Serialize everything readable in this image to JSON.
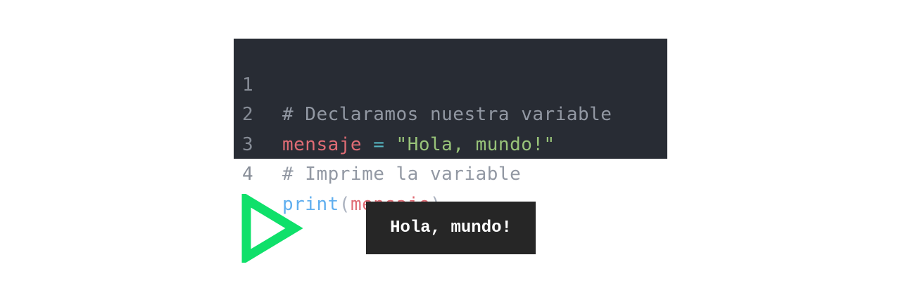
{
  "code_editor": {
    "lines": [
      {
        "number": "1",
        "tokens": [
          {
            "type": "comment",
            "text": "# Declaramos nuestra variable"
          }
        ]
      },
      {
        "number": "2",
        "tokens": [
          {
            "type": "var",
            "text": "mensaje"
          },
          {
            "type": "punc",
            "text": " "
          },
          {
            "type": "op",
            "text": "="
          },
          {
            "type": "punc",
            "text": " "
          },
          {
            "type": "str",
            "text": "\"Hola, mundo!\""
          }
        ]
      },
      {
        "number": "3",
        "tokens": [
          {
            "type": "comment",
            "text": "# Imprime la variable"
          }
        ]
      },
      {
        "number": "4",
        "tokens": [
          {
            "type": "func",
            "text": "print"
          },
          {
            "type": "punc",
            "text": "("
          },
          {
            "type": "var",
            "text": "mensaje"
          },
          {
            "type": "punc",
            "text": ")"
          }
        ]
      }
    ],
    "colors": {
      "background": "#282c34",
      "line_number": "#868c96",
      "comment": "#9298a3",
      "variable": "#e06c75",
      "operator": "#56b6c2",
      "string": "#98c379",
      "function": "#61afef"
    }
  },
  "run_indicator": {
    "icon": "play-icon",
    "color": "#0fe06a"
  },
  "output": {
    "text": "Hola, mundo!",
    "background": "#262626",
    "color": "#ffffff"
  }
}
